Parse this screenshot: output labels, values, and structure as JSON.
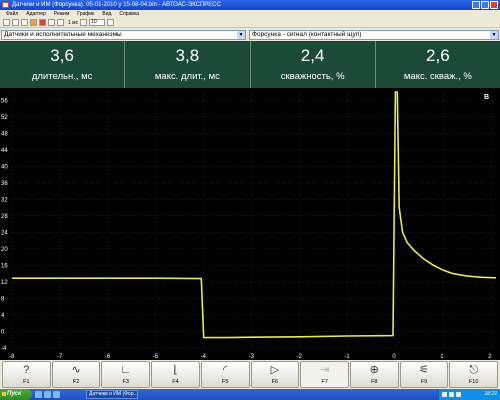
{
  "window": {
    "title": "Датчики и ИМ (Форсунка). 05-01-2010 у 15-08-04.bin - АВТОАС-ЭКСПРЕСС"
  },
  "menu": [
    "Файл",
    "Адаптер",
    "Режим",
    "График",
    "Вид",
    "Справка"
  ],
  "toolbar": {
    "interval_label": "1 мс",
    "spin_value": "10"
  },
  "selectors": {
    "group": "Датчики и исполнительные механизмы",
    "signal": "Форсунка - сигнал (контактный щуп)"
  },
  "readouts": [
    {
      "value": "3,6",
      "caption": "длительн., мс"
    },
    {
      "value": "3,8",
      "caption": "макс. длит., мс"
    },
    {
      "value": "2,4",
      "caption": "скважность, %"
    },
    {
      "value": "2,6",
      "caption": "макс. скваж., %"
    }
  ],
  "chart_data": {
    "type": "line",
    "unit_label": "В",
    "x_ticks": [
      "-8",
      "-7",
      "-6",
      "-5",
      "-4",
      "-3",
      "-2",
      "-1",
      "0",
      "1",
      "2"
    ],
    "y_ticks": [
      "56",
      "52",
      "48",
      "44",
      "40",
      "36",
      "32",
      "28",
      "24",
      "20",
      "16",
      "12",
      "8",
      "4",
      "0",
      "-4"
    ],
    "xlim": [
      -8,
      2.1
    ],
    "ylim": [
      -4.5,
      58
    ],
    "grid": true,
    "series": [
      {
        "color": "#e8e860",
        "x": [
          -8,
          -7,
          -6,
          -5,
          -4.05,
          -4.0,
          -3.5,
          -3,
          -2,
          -1,
          -0.05,
          0,
          0.04,
          0.08,
          0.15,
          0.25,
          0.4,
          0.6,
          0.8,
          1.0,
          1.2,
          1.5,
          1.8,
          2.1
        ],
        "y": [
          12.9,
          12.9,
          12.9,
          12.9,
          12.8,
          -1.5,
          -1.5,
          -1.4,
          -1.3,
          -1.1,
          -1.0,
          58,
          58,
          30,
          24,
          21.5,
          19.5,
          17.5,
          16.0,
          14.8,
          14.0,
          13.4,
          13.1,
          13.0
        ]
      }
    ]
  },
  "fkeys": [
    {
      "icon": "question-icon",
      "glyph": "?",
      "label": "F1",
      "enabled": true
    },
    {
      "icon": "curve-cursor-icon",
      "glyph": "∿",
      "label": "F2",
      "enabled": true
    },
    {
      "icon": "axis-cursor-icon",
      "glyph": "∟",
      "label": "F3",
      "enabled": true
    },
    {
      "icon": "corner-axis-icon",
      "glyph": "⌊",
      "label": "F4",
      "enabled": true
    },
    {
      "icon": "gauge-icon",
      "glyph": "◜",
      "label": "F5",
      "enabled": true
    },
    {
      "icon": "play-icon",
      "glyph": "▷",
      "label": "F6",
      "enabled": true
    },
    {
      "icon": "step-arrow-icon",
      "glyph": "⇥",
      "label": "F7",
      "enabled": false
    },
    {
      "icon": "crosshair-icon",
      "glyph": "⊕",
      "label": "F8",
      "enabled": true
    },
    {
      "icon": "switch-icon",
      "glyph": "⚟",
      "label": "F9",
      "enabled": true
    },
    {
      "icon": "exit-icon",
      "glyph": "⎋",
      "label": "F10",
      "enabled": true
    }
  ],
  "taskbar": {
    "start_label": "Пуск",
    "task_label": "Датчики и ИМ (Фор...",
    "clock": "18:22"
  }
}
